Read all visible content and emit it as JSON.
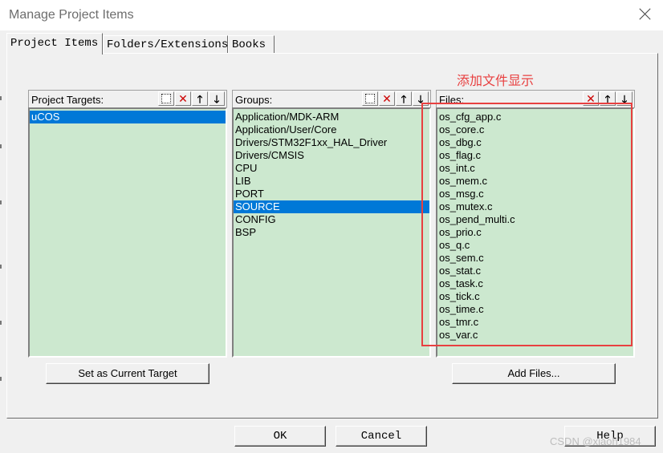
{
  "window": {
    "title": "Manage Project Items"
  },
  "tabs": [
    {
      "label": "Project Items",
      "active": true
    },
    {
      "label": "Folders/Extensions",
      "active": false
    },
    {
      "label": "Books",
      "active": false
    }
  ],
  "annotation": {
    "text": "添加文件显示",
    "color": "#e84040"
  },
  "targets": {
    "header": "Project Targets:",
    "items": [
      "uCOS"
    ],
    "selected_index": 0
  },
  "groups": {
    "header": "Groups:",
    "items": [
      "Application/MDK-ARM",
      "Application/User/Core",
      "Drivers/STM32F1xx_HAL_Driver",
      "Drivers/CMSIS",
      "CPU",
      "LIB",
      "PORT",
      "SOURCE",
      "CONFIG",
      "BSP"
    ],
    "selected_index": 7
  },
  "files": {
    "header": "Files:",
    "items": [
      "os_cfg_app.c",
      "os_core.c",
      "os_dbg.c",
      "os_flag.c",
      "os_int.c",
      "os_mem.c",
      "os_msg.c",
      "os_mutex.c",
      "os_pend_multi.c",
      "os_prio.c",
      "os_q.c",
      "os_sem.c",
      "os_stat.c",
      "os_task.c",
      "os_tick.c",
      "os_time.c",
      "os_tmr.c",
      "os_var.c"
    ]
  },
  "buttons": {
    "set_target": "Set as Current Target",
    "add_files": "Add Files...",
    "ok": "OK",
    "cancel": "Cancel",
    "help": "Help"
  },
  "header_icons": {
    "new": "new-item-icon",
    "delete": "delete-icon",
    "up": "move-up-icon",
    "down": "move-down-icon",
    "new_glyph": "",
    "delete_glyph": "✕",
    "up_glyph": "🡑",
    "down_glyph": "🡓"
  },
  "colors": {
    "list_bg": "#cce8cf",
    "selection": "#0078d7"
  },
  "watermark": "CSDN @xiaoh1984"
}
